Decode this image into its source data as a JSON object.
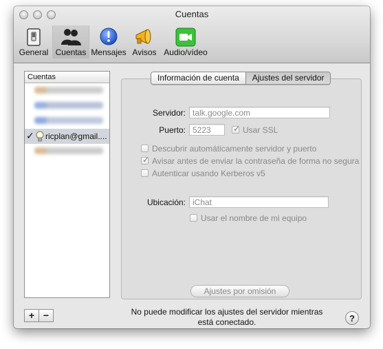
{
  "window": {
    "title": "Cuentas"
  },
  "toolbar": [
    {
      "label": "General",
      "icon": "general-switch-icon"
    },
    {
      "label": "Cuentas",
      "icon": "accounts-people-icon"
    },
    {
      "label": "Mensajes",
      "icon": "messages-exclamation-icon"
    },
    {
      "label": "Avisos",
      "icon": "alerts-megaphone-icon"
    },
    {
      "label": "Audio/vídeo",
      "icon": "video-camera-icon"
    }
  ],
  "accounts": {
    "header": "Cuentas",
    "selected_account": "ricplan@gmail....",
    "add_label": "+",
    "remove_label": "−"
  },
  "tabs": {
    "account_info": "Información de cuenta",
    "server_settings": "Ajustes del servidor"
  },
  "server": {
    "label": "Servidor:",
    "value": "talk.google.com"
  },
  "port": {
    "label": "Puerto:",
    "value": "5223",
    "ssl_label": "Usar SSL",
    "ssl_checked": "✓"
  },
  "options": {
    "autodiscover": "Descubrir automáticamente servidor y puerto",
    "warn_insecure": "Avisar antes de enviar la contraseña de forma no segura",
    "warn_checked": "✓",
    "kerberos": "Autenticar usando Kerberos v5"
  },
  "location": {
    "label": "Ubicación:",
    "value": "iChat",
    "use_computer_name": "Usar el nombre de mi equipo"
  },
  "defaults_button": "Ajustes por omisión",
  "footer": {
    "message_line1": "No puede modificar los ajustes del servidor mientras",
    "message_line2": "está conectado.",
    "help_label": "?"
  }
}
